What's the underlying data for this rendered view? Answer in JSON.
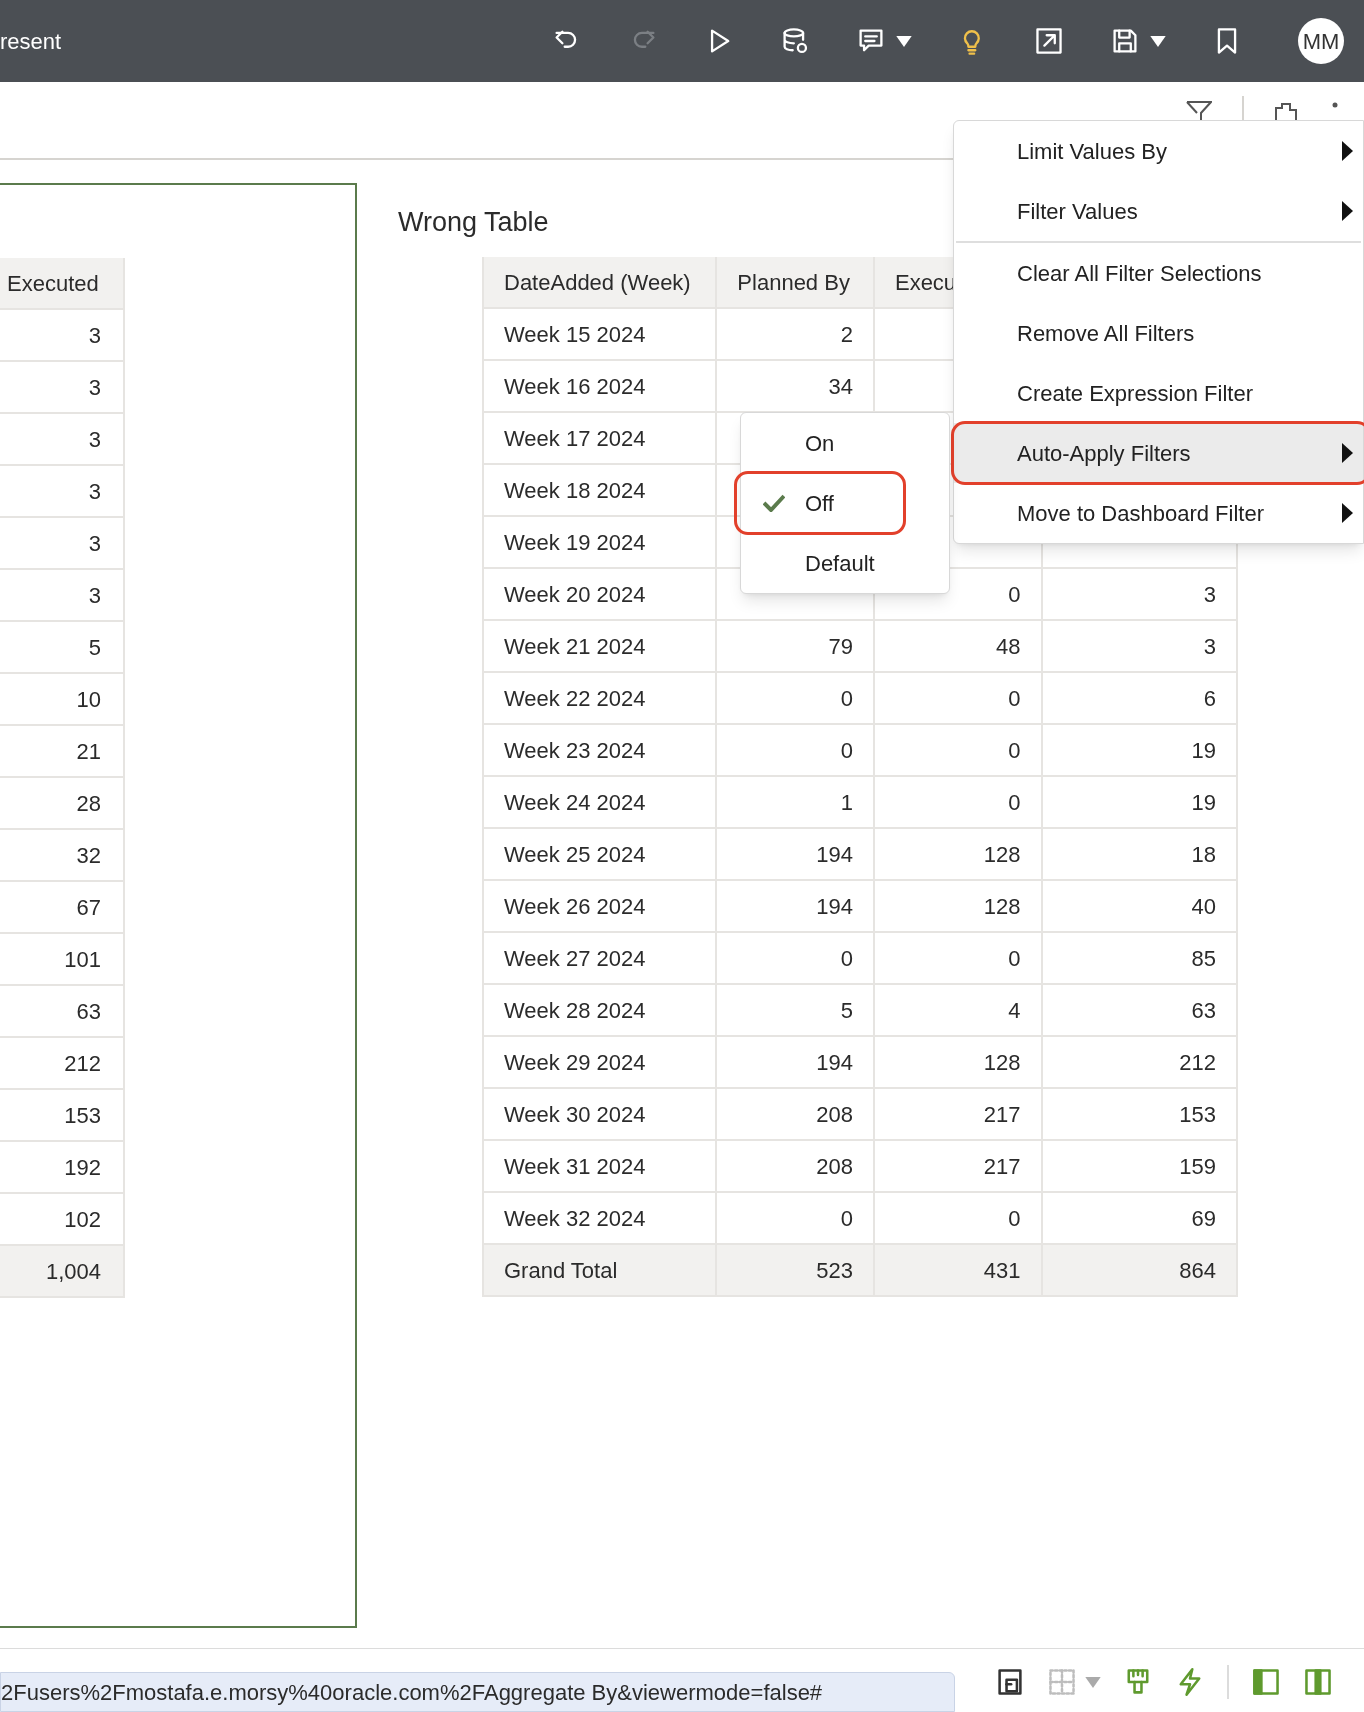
{
  "header": {
    "title": "resent",
    "toolbar": [
      {
        "kind": "undo",
        "disabled": false,
        "dropdown": false
      },
      {
        "kind": "redo",
        "disabled": true,
        "dropdown": false
      },
      {
        "kind": "play",
        "disabled": false,
        "dropdown": false
      },
      {
        "kind": "data-refresh",
        "disabled": false,
        "dropdown": false
      },
      {
        "kind": "comment",
        "disabled": false,
        "dropdown": true
      },
      {
        "kind": "bulb",
        "disabled": false,
        "dropdown": false
      },
      {
        "kind": "export",
        "disabled": false,
        "dropdown": false
      },
      {
        "kind": "save",
        "disabled": false,
        "dropdown": true
      },
      {
        "kind": "bookmark",
        "disabled": false,
        "dropdown": false
      }
    ],
    "avatar": "MM"
  },
  "left_table": {
    "columns": [
      "Executed"
    ],
    "rows": [
      "3",
      "3",
      "3",
      "3",
      "3",
      "3",
      "5",
      "10",
      "21",
      "28",
      "32",
      "67",
      "101",
      "63",
      "212",
      "153",
      "192",
      "102"
    ],
    "total": "1,004"
  },
  "wrong_table": {
    "title": "Wrong Table",
    "columns": [
      "DateAdded (Week)",
      "Planned By",
      "Execu"
    ],
    "rows": [
      [
        "Week 15 2024",
        "2",
        null,
        null
      ],
      [
        "Week 16 2024",
        "34",
        null,
        null
      ],
      [
        "Week 17 2024",
        null,
        null,
        null
      ],
      [
        "Week 18 2024",
        null,
        null,
        null
      ],
      [
        "Week 19 2024",
        null,
        null,
        null
      ],
      [
        "Week 20 2024",
        null,
        "0",
        "3"
      ],
      [
        "Week 21 2024",
        "79",
        "48",
        "3"
      ],
      [
        "Week 22 2024",
        "0",
        "0",
        "6"
      ],
      [
        "Week 23 2024",
        "0",
        "0",
        "19"
      ],
      [
        "Week 24 2024",
        "1",
        "0",
        "19"
      ],
      [
        "Week 25 2024",
        "194",
        "128",
        "18"
      ],
      [
        "Week 26 2024",
        "194",
        "128",
        "40"
      ],
      [
        "Week 27 2024",
        "0",
        "0",
        "85"
      ],
      [
        "Week 28 2024",
        "5",
        "4",
        "63"
      ],
      [
        "Week 29 2024",
        "194",
        "128",
        "212"
      ],
      [
        "Week 30 2024",
        "208",
        "217",
        "153"
      ],
      [
        "Week 31 2024",
        "208",
        "217",
        "159"
      ],
      [
        "Week 32 2024",
        "0",
        "0",
        "69"
      ]
    ],
    "total": [
      "Grand Total",
      "523",
      "431",
      "864"
    ]
  },
  "context_menu": {
    "items": [
      {
        "kind": "item",
        "label": "Limit Values By",
        "submenu": true,
        "selected": false,
        "outlined": false
      },
      {
        "kind": "item",
        "label": "Filter Values",
        "submenu": true,
        "selected": false,
        "outlined": false
      },
      {
        "kind": "divider"
      },
      {
        "kind": "item",
        "label": "Clear All Filter Selections",
        "submenu": false,
        "selected": false,
        "outlined": false
      },
      {
        "kind": "item",
        "label": "Remove All Filters",
        "submenu": false,
        "selected": false,
        "outlined": false
      },
      {
        "kind": "item",
        "label": "Create Expression Filter",
        "submenu": false,
        "selected": false,
        "outlined": false
      },
      {
        "kind": "item",
        "label": "Auto-Apply Filters",
        "submenu": true,
        "selected": true,
        "outlined": true
      },
      {
        "kind": "item",
        "label": "Move to Dashboard Filter",
        "submenu": true,
        "selected": false,
        "outlined": false
      }
    ]
  },
  "submenu": {
    "items": [
      {
        "label": "On",
        "checked": false,
        "outlined": false
      },
      {
        "label": "Off",
        "checked": true,
        "outlined": true
      },
      {
        "label": "Default",
        "checked": false,
        "outlined": false
      }
    ]
  },
  "footer": {
    "url": "2Fusers%2Fmostafa.e.morsy%40oracle.com%2FAggregate By&viewermode=false#",
    "tools": [
      {
        "kind": "page",
        "disabled": false,
        "dropdown": false
      },
      {
        "kind": "grid",
        "disabled": true,
        "dropdown": true
      },
      {
        "kind": "brush",
        "disabled": false,
        "dropdown": false
      },
      {
        "kind": "bolt",
        "disabled": false,
        "dropdown": false
      },
      {
        "kind": "panel-left",
        "disabled": false,
        "dropdown": false
      },
      {
        "kind": "panel-split",
        "disabled": false,
        "dropdown": false
      }
    ]
  }
}
